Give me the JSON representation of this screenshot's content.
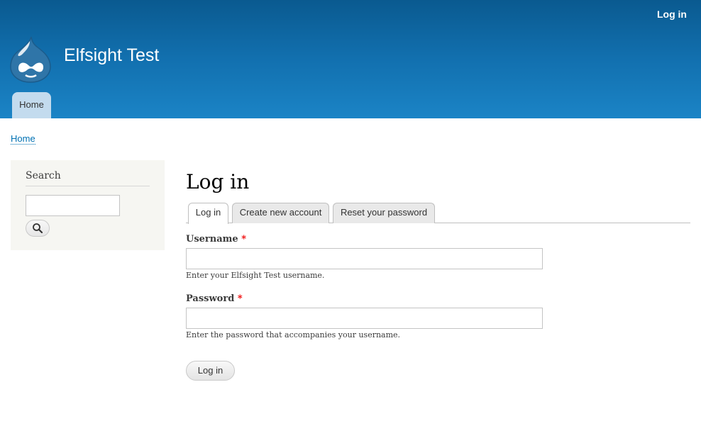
{
  "header": {
    "site_name": "Elfsight Test",
    "secondary_menu": {
      "login_link": "Log in"
    },
    "main_menu": [
      {
        "label": "Home"
      }
    ],
    "colors": {
      "gradient_top": "#0a5a90",
      "gradient_bottom": "#1b84c6",
      "active_tab": "#c3dbee"
    }
  },
  "breadcrumb": {
    "items": [
      {
        "label": "Home"
      }
    ]
  },
  "sidebar": {
    "search_block": {
      "title": "Search",
      "input_value": "",
      "button_icon": "search-icon"
    }
  },
  "main": {
    "title": "Log in",
    "tabs": [
      {
        "label": "Log in",
        "active": true
      },
      {
        "label": "Create new account",
        "active": false
      },
      {
        "label": "Reset your password",
        "active": false
      }
    ],
    "form": {
      "username": {
        "label": "Username",
        "required_mark": "*",
        "value": "",
        "description": "Enter your Elfsight Test username."
      },
      "password": {
        "label": "Password",
        "required_mark": "*",
        "value": "",
        "description": "Enter the password that accompanies your username."
      },
      "submit_label": "Log in"
    }
  }
}
